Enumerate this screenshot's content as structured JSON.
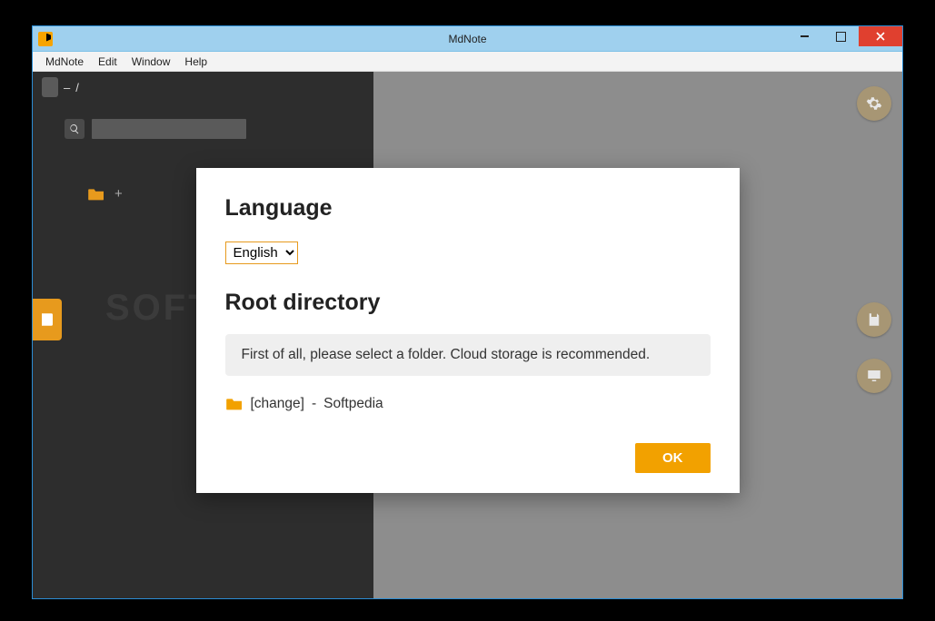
{
  "window": {
    "title": "MdNote"
  },
  "menu": {
    "items": [
      "MdNote",
      "Edit",
      "Window",
      "Help"
    ]
  },
  "sidebar": {
    "breadcrumb_minus": "–",
    "breadcrumb_sep": "/",
    "add_plus": "+"
  },
  "watermark": "SOFTPEDIA",
  "modal": {
    "language_heading": "Language",
    "language_value": "English",
    "root_heading": "Root directory",
    "info": "First of all, please select a folder. Cloud storage is recommended.",
    "change_label": "[change]",
    "change_sep": "-",
    "change_value": "Softpedia",
    "ok": "OK"
  }
}
